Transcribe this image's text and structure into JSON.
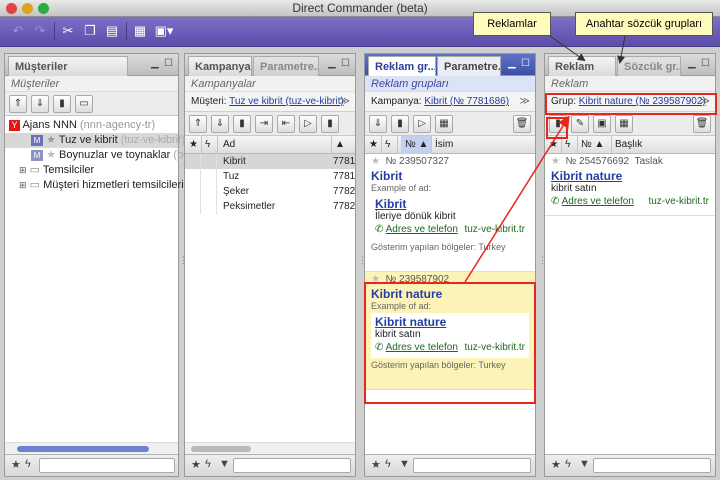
{
  "window": {
    "title": "Direct Commander (beta)"
  },
  "panels": {
    "clients": {
      "tab": "Müşteriler",
      "subtitle": "Müşteriler",
      "tree": [
        {
          "label": "Ajans NNN",
          "sub": "(nnn-agency-tr)"
        },
        {
          "label": "Tuz ve kibrit",
          "sub": "(tuz-ve-kibrit)"
        },
        {
          "label": "Boynuzlar ve toynaklar",
          "sub": "(bo"
        },
        {
          "label": "Temsilciler",
          "sub": ""
        },
        {
          "label": "Müşteri hizmetleri temsilcileri",
          "sub": ""
        }
      ]
    },
    "campaigns": {
      "tab_active": "Kampanyalar",
      "tab_inactive": "Parametre...",
      "subtitle": "Kampanyalar",
      "filter_label": "Müşteri:",
      "filter_value": "Tuz ve kibrit (tuz-ve-kibrit)",
      "col_name": "Ad",
      "rows": [
        {
          "name": "Kibrit",
          "id": "7781"
        },
        {
          "name": "Tuz",
          "id": "7781"
        },
        {
          "name": "Şeker",
          "id": "7782"
        },
        {
          "name": "Peksimetler",
          "id": "7782"
        }
      ]
    },
    "adgroups": {
      "tab_active": "Reklam gr...",
      "tab_inactive": "Parametre...",
      "subtitle": "Reklam grupları",
      "filter_label": "Kampanya:",
      "filter_value": "Kibrit (№ 7781686)",
      "col_num": "№",
      "col_name": "İsim",
      "groups": [
        {
          "num": "№ 239507327",
          "name": "Kibrit",
          "example": "Example of ad:",
          "ad_title": "Kibrit",
          "ad_text": "İleriye dönük kibrit",
          "contact": "Adres ve telefon",
          "url": "tuz-ve-kibrit.tr",
          "regions": "Gösterim yapılan bölgeler: Turkey"
        },
        {
          "num": "№ 239587902",
          "name": "Kibrit nature",
          "example": "Example of ad:",
          "ad_title": "Kibrit nature",
          "ad_text": "kibrit satın",
          "contact": "Adres ve telefon",
          "url": "tuz-ve-kibrit.tr",
          "regions": "Gösterim yapılan bölgeler: Turkey"
        }
      ]
    },
    "ads": {
      "tab_active": "Reklam",
      "tab_inactive": "Sözcük gr...",
      "subtitle": "Reklam",
      "filter_label": "Grup:",
      "filter_value": "Kibrit nature (№ 239587902)",
      "col_num": "№",
      "col_title": "Başlık",
      "ad": {
        "num": "№ 254576692",
        "status": "Taslak",
        "title": "Kibrit nature",
        "text": "kibrit satın",
        "contact": "Adres ve telefon",
        "url": "tuz-ve-kibrit.tr"
      }
    }
  },
  "callouts": {
    "ads": "Reklamlar",
    "keywords": "Anahtar sözcük grupları"
  }
}
